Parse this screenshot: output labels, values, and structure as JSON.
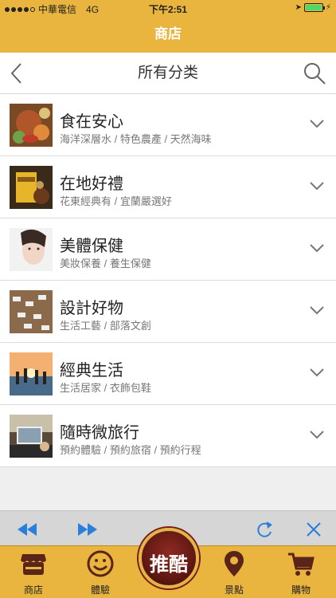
{
  "status": {
    "carrier": "中華電信",
    "network": "4G",
    "time": "下午2:51"
  },
  "nav": {
    "title": "商店"
  },
  "header": {
    "title": "所有分类"
  },
  "categories": [
    {
      "title": "食在安心",
      "subtitle": "海洋深層水 / 特色農產 / 天然海味"
    },
    {
      "title": "在地好禮",
      "subtitle": "花東經典有 / 宜蘭嚴選好"
    },
    {
      "title": "美體保健",
      "subtitle": "美妝保養 / 養生保健"
    },
    {
      "title": "設計好物",
      "subtitle": "生活工藝 / 部落文創"
    },
    {
      "title": "經典生活",
      "subtitle": "生活居家 / 衣飾包鞋"
    },
    {
      "title": "隨時微旅行",
      "subtitle": "預約體驗 / 預約旅宿 / 預約行程"
    }
  ],
  "tabs": [
    {
      "label": "商店",
      "icon": "store-icon"
    },
    {
      "label": "體驗",
      "icon": "smiley-icon"
    },
    {
      "label": "推酷",
      "icon": "tuiku-badge"
    },
    {
      "label": "景點",
      "icon": "location-pin-icon"
    },
    {
      "label": "購物",
      "icon": "shopping-cart-icon"
    }
  ],
  "colors": {
    "brand": "#e9b53e",
    "accent_blue": "#2a7fd8",
    "badge": "#7a1a12"
  }
}
